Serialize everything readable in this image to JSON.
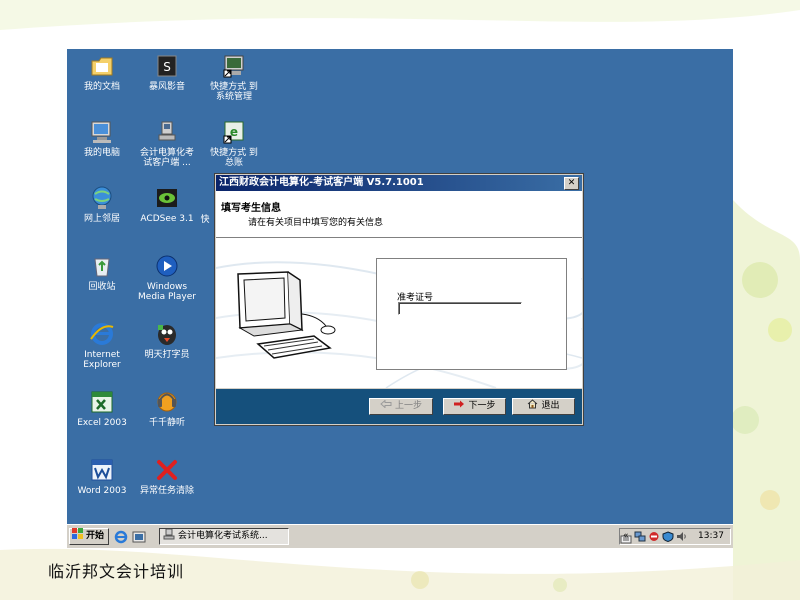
{
  "desktop": {
    "icons": [
      {
        "label": "我的文档",
        "icon": "my-documents-icon"
      },
      {
        "label": "暴风影音",
        "icon": "media-player-icon"
      },
      {
        "label": "快捷方式 到\n系统管理",
        "icon": "shortcut-system-icon"
      },
      {
        "label": "我的电脑",
        "icon": "my-computer-icon"
      },
      {
        "label": "会计电算化考\n试客户端 ...",
        "icon": "exam-client-icon"
      },
      {
        "label": "快捷方式 到\n总账",
        "icon": "shortcut-ledger-icon"
      },
      {
        "label": "网上邻居",
        "icon": "network-icon"
      },
      {
        "label": "ACDSee 3.1",
        "icon": "acdsee-icon"
      },
      {
        "label": "回收站",
        "icon": "recycle-bin-icon"
      },
      {
        "label": "Windows\nMedia Player",
        "icon": "windows-media-player-icon"
      },
      {
        "label": "Internet\nExplorer",
        "icon": "internet-explorer-icon"
      },
      {
        "label": "明天打字员",
        "icon": "typing-tutor-icon"
      },
      {
        "label": "Excel 2003",
        "icon": "excel-icon"
      },
      {
        "label": "千千静听",
        "icon": "music-player-icon"
      },
      {
        "label": "Word 2003",
        "icon": "word-icon"
      },
      {
        "label": "异常任务清除",
        "icon": "task-cleaner-icon"
      }
    ],
    "partial_icon_label": "快"
  },
  "dialog": {
    "title": "江西财政会计电算化-考试客户端 V5.7.1001",
    "close_glyph": "✕",
    "header_title": "填写考生信息",
    "header_subtitle": "请在有关项目中填写您的有关信息",
    "field_label": "准考证号",
    "field_value": "",
    "buttons": {
      "prev": "上一步",
      "next": "下一步",
      "exit": "退出"
    }
  },
  "taskbar": {
    "start_label": "开始",
    "task_label": "会计电算化考试系统...",
    "tray_chevron": "«",
    "clock": "13:37"
  },
  "caption": "临沂邦文会计培训",
  "colors": {
    "desktop": "#3a6ea5",
    "title_bar": "#0a246a",
    "dialog_footer": "#15507c",
    "face": "#d4d0c8"
  }
}
